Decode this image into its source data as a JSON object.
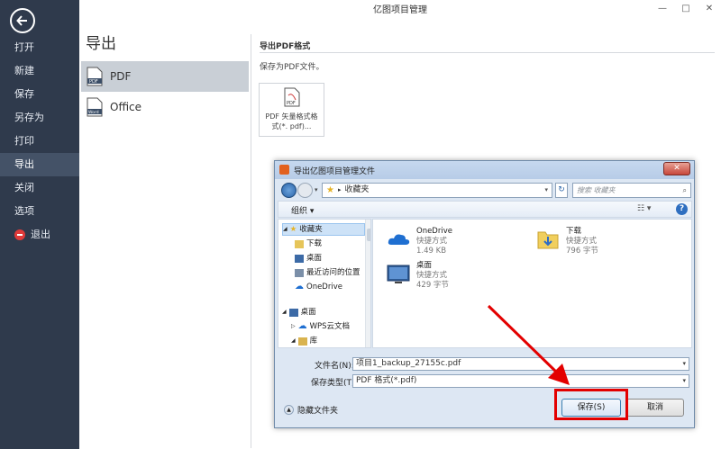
{
  "app": {
    "title": "亿图项目管理"
  },
  "window_controls": {
    "minimize": "—",
    "restore": "□",
    "close": "✕"
  },
  "sidebar": {
    "items": [
      {
        "label": "打开"
      },
      {
        "label": "新建"
      },
      {
        "label": "保存"
      },
      {
        "label": "另存为"
      },
      {
        "label": "打印"
      },
      {
        "label": "导出"
      },
      {
        "label": "关闭"
      },
      {
        "label": "选项"
      },
      {
        "label": "退出"
      }
    ]
  },
  "main": {
    "title": "导出",
    "export_options": [
      {
        "label": "PDF"
      },
      {
        "label": "Office"
      }
    ],
    "right": {
      "title": "导出PDF格式",
      "description": "保存为PDF文件。",
      "card_label": "PDF 矢量格式格式(*. pdf)..."
    }
  },
  "dialog": {
    "title": "导出亿图项目管理文件",
    "address": "收藏夹",
    "search_placeholder": "搜索 收藏夹",
    "organize": "组织 ▾",
    "nav_tree": [
      {
        "label": "收藏夹"
      },
      {
        "label": "下载"
      },
      {
        "label": "桌面"
      },
      {
        "label": "最近访问的位置"
      },
      {
        "label": "OneDrive"
      },
      {
        "label": "桌面"
      },
      {
        "label": "WPS云文档"
      },
      {
        "label": "库"
      }
    ],
    "files": [
      {
        "name": "OneDrive",
        "type": "快捷方式",
        "size": "1.49 KB"
      },
      {
        "name": "下载",
        "type": "快捷方式",
        "size": "796 字节"
      },
      {
        "name": "桌面",
        "type": "快捷方式",
        "size": "429 字节"
      }
    ],
    "filename_label": "文件名(N):",
    "filename_value": "项目1_backup_27155c.pdf",
    "filetype_label": "保存类型(T):",
    "filetype_value": "PDF 格式(*.pdf)",
    "hide_folders": "隐藏文件夹",
    "save_label": "保存(S)",
    "cancel_label": "取消"
  },
  "colors": {
    "sidebar_bg": "#2f3a4c",
    "annotation_red": "#e30000",
    "dialog_bg": "#dde7f3"
  }
}
